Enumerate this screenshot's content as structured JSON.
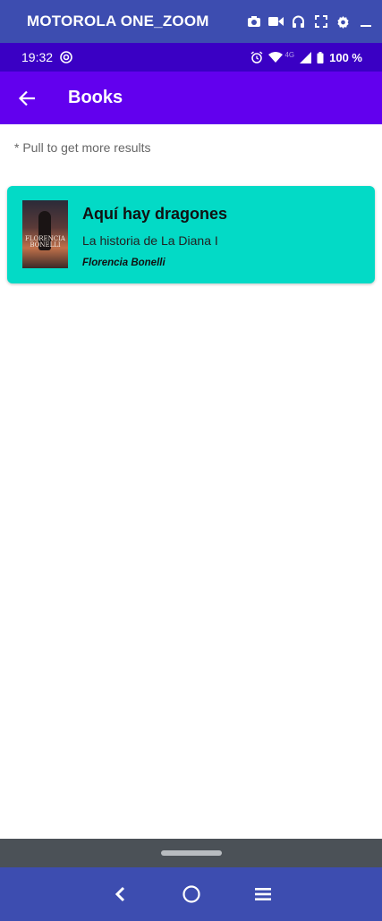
{
  "emulator": {
    "title": "MOTOROLA ONE_ZOOM",
    "icons": [
      "camera-icon",
      "video-icon",
      "headphones-icon",
      "fullscreen-icon",
      "settings-icon",
      "minimize-icon"
    ]
  },
  "status_bar": {
    "time": "19:32",
    "network": "4G",
    "battery": "100 %"
  },
  "app_bar": {
    "title": "Books"
  },
  "hint": "* Pull to get more results",
  "books": [
    {
      "title": "Aquí hay dragones",
      "subtitle": "La historia de La Diana I",
      "author": "Florencia Bonelli",
      "cover_text": "FLORENCIA BONELLI"
    }
  ],
  "colors": {
    "emulator": "#3d4db0",
    "status_bar": "#3a00c4",
    "app_bar": "#6200ee",
    "card": "#03dac6",
    "gesture_area": "#4b5157"
  }
}
